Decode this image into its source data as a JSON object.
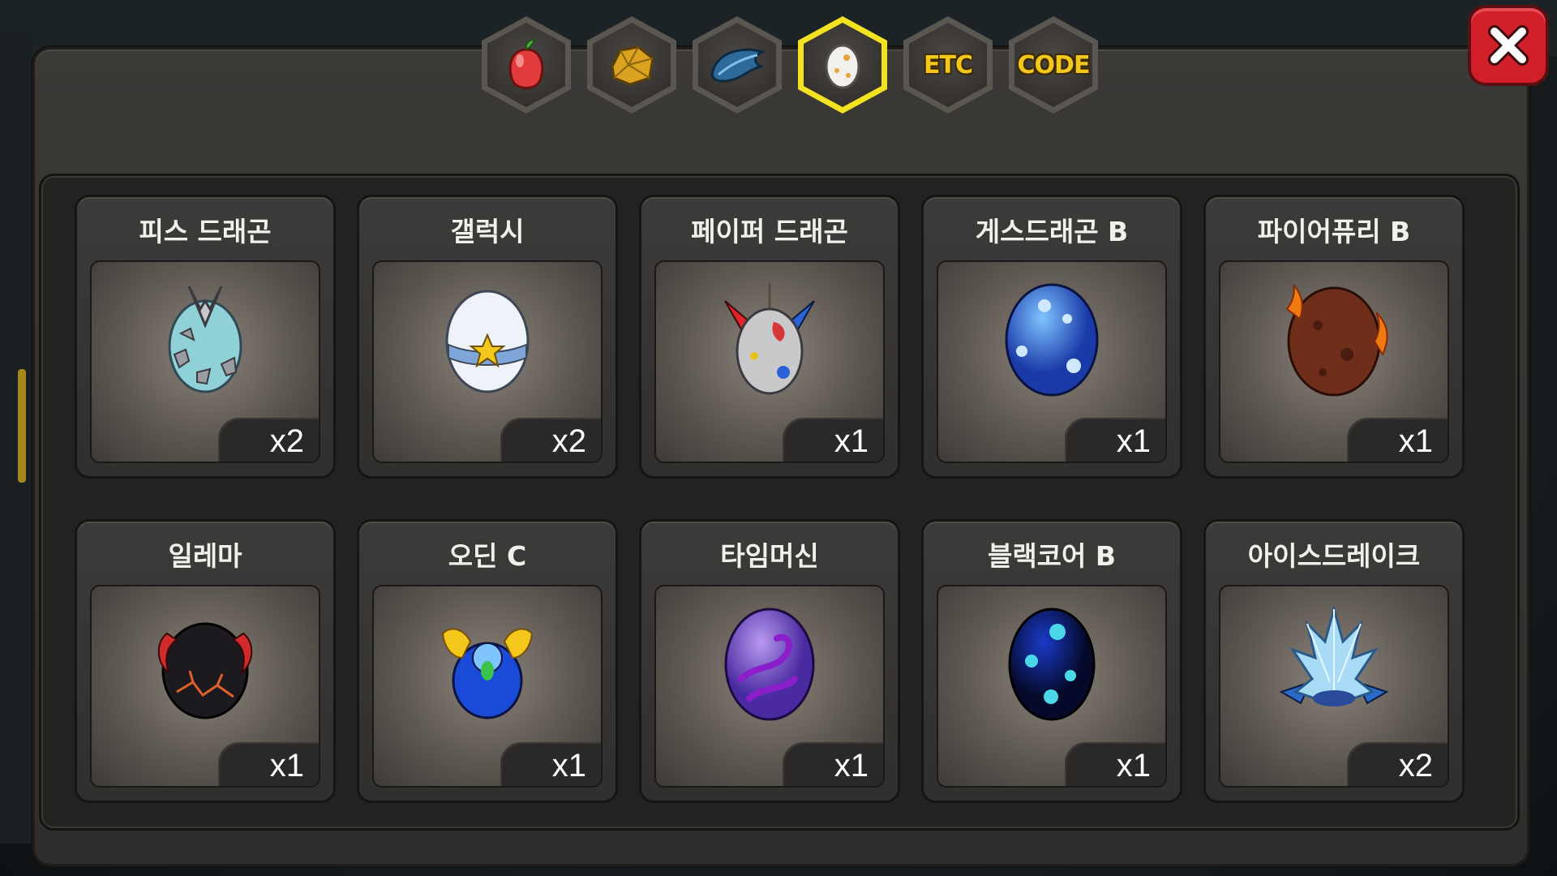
{
  "tabs": [
    {
      "name": "fruit-tab",
      "icon": "fruit-icon",
      "label": ""
    },
    {
      "name": "ore-tab",
      "icon": "ore-icon",
      "label": ""
    },
    {
      "name": "feather-tab",
      "icon": "feather-icon",
      "label": ""
    },
    {
      "name": "egg-tab",
      "icon": "egg-icon",
      "label": "",
      "active": true
    },
    {
      "name": "etc-tab",
      "icon": "",
      "label": "ETC"
    },
    {
      "name": "code-tab",
      "icon": "",
      "label": "CODE"
    }
  ],
  "items": [
    {
      "name": "피스 드래곤",
      "count": "x2",
      "egg": "peace-dragon-egg-icon"
    },
    {
      "name": "갤럭시",
      "count": "x2",
      "egg": "galaxy-egg-icon"
    },
    {
      "name": "페이퍼 드래곤",
      "count": "x1",
      "egg": "paper-dragon-egg-icon"
    },
    {
      "name": "게스드래곤 B",
      "count": "x1",
      "egg": "gas-dragon-egg-icon"
    },
    {
      "name": "파이어퓨리 B",
      "count": "x1",
      "egg": "firefury-egg-icon"
    },
    {
      "name": "일레마",
      "count": "x1",
      "egg": "ilema-egg-icon"
    },
    {
      "name": "오딘 C",
      "count": "x1",
      "egg": "odin-egg-icon"
    },
    {
      "name": "타임머신",
      "count": "x1",
      "egg": "time-machine-egg-icon"
    },
    {
      "name": "블랙코어 B",
      "count": "x1",
      "egg": "blackcore-egg-icon"
    },
    {
      "name": "아이스드레이크",
      "count": "x2",
      "egg": "ice-drake-egg-icon"
    }
  ],
  "colors": {
    "accent": "#f2e21f",
    "close": "#d11f2a",
    "tab_text": "#f3c81b"
  }
}
